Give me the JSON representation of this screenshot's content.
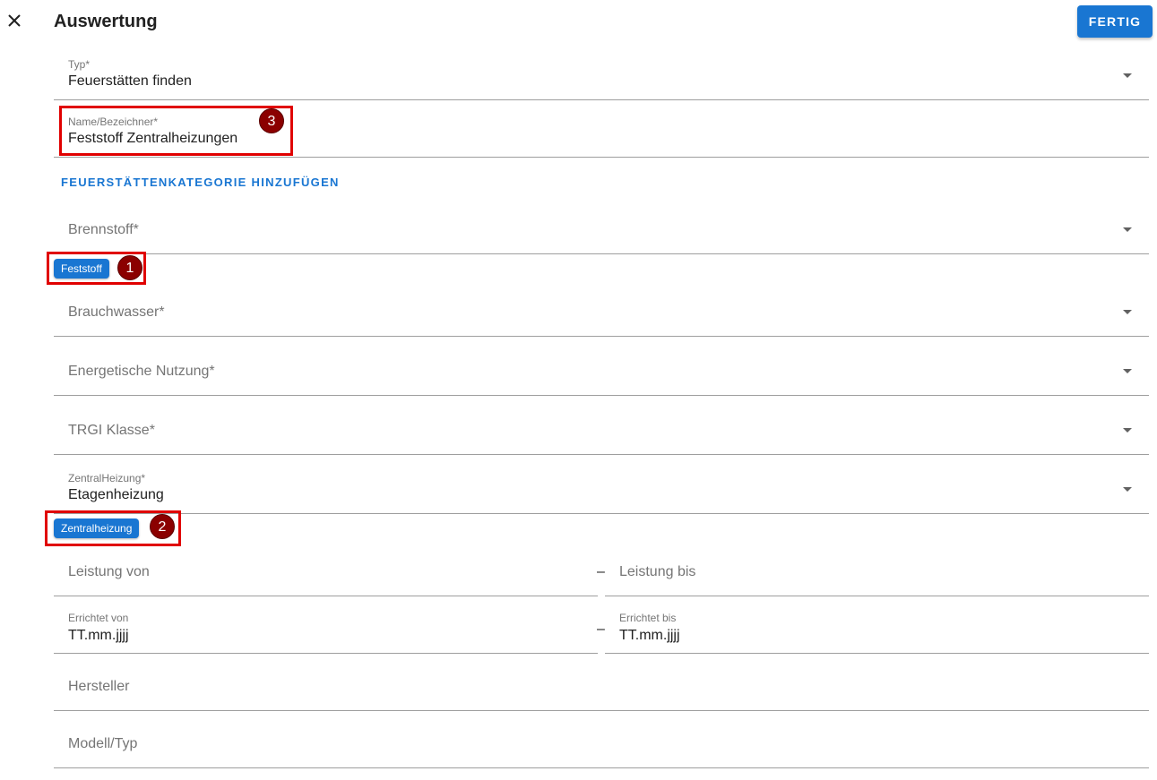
{
  "header": {
    "title": "Auswertung",
    "done_label": "FERTIG"
  },
  "form": {
    "typ": {
      "label": "Typ*",
      "value": "Feuerstätten finden"
    },
    "name": {
      "label": "Name/Bezeichner*",
      "value": "Feststoff Zentralheizungen"
    },
    "add_category_label": "FEUERSTÄTTENKATEGORIE HINZUFÜGEN",
    "brennstoff": {
      "placeholder": "Brennstoff*",
      "chip": "Feststoff"
    },
    "brauchwasser": {
      "placeholder": "Brauchwasser*"
    },
    "energetische_nutzung": {
      "placeholder": "Energetische Nutzung*"
    },
    "trgi_klasse": {
      "placeholder": "TRGI Klasse*"
    },
    "zentralheizung": {
      "label": "ZentralHeizung*",
      "value": "Etagenheizung",
      "chip": "Zentralheizung"
    },
    "leistung_von": {
      "placeholder": "Leistung von"
    },
    "leistung_bis": {
      "placeholder": "Leistung bis"
    },
    "errichtet_von": {
      "label": "Errichtet von",
      "value": "TT.mm.jjjj"
    },
    "errichtet_bis": {
      "label": "Errichtet bis",
      "value": "TT.mm.jjjj"
    },
    "hersteller": {
      "placeholder": "Hersteller"
    },
    "modell_typ": {
      "placeholder": "Modell/Typ"
    },
    "range_separator": "–"
  },
  "annotations": {
    "badge_1": "1",
    "badge_2": "2",
    "badge_3": "3",
    "highlight_color": "#e00000",
    "badge_color": "#8b0000"
  },
  "colors": {
    "primary": "#1976d2"
  }
}
